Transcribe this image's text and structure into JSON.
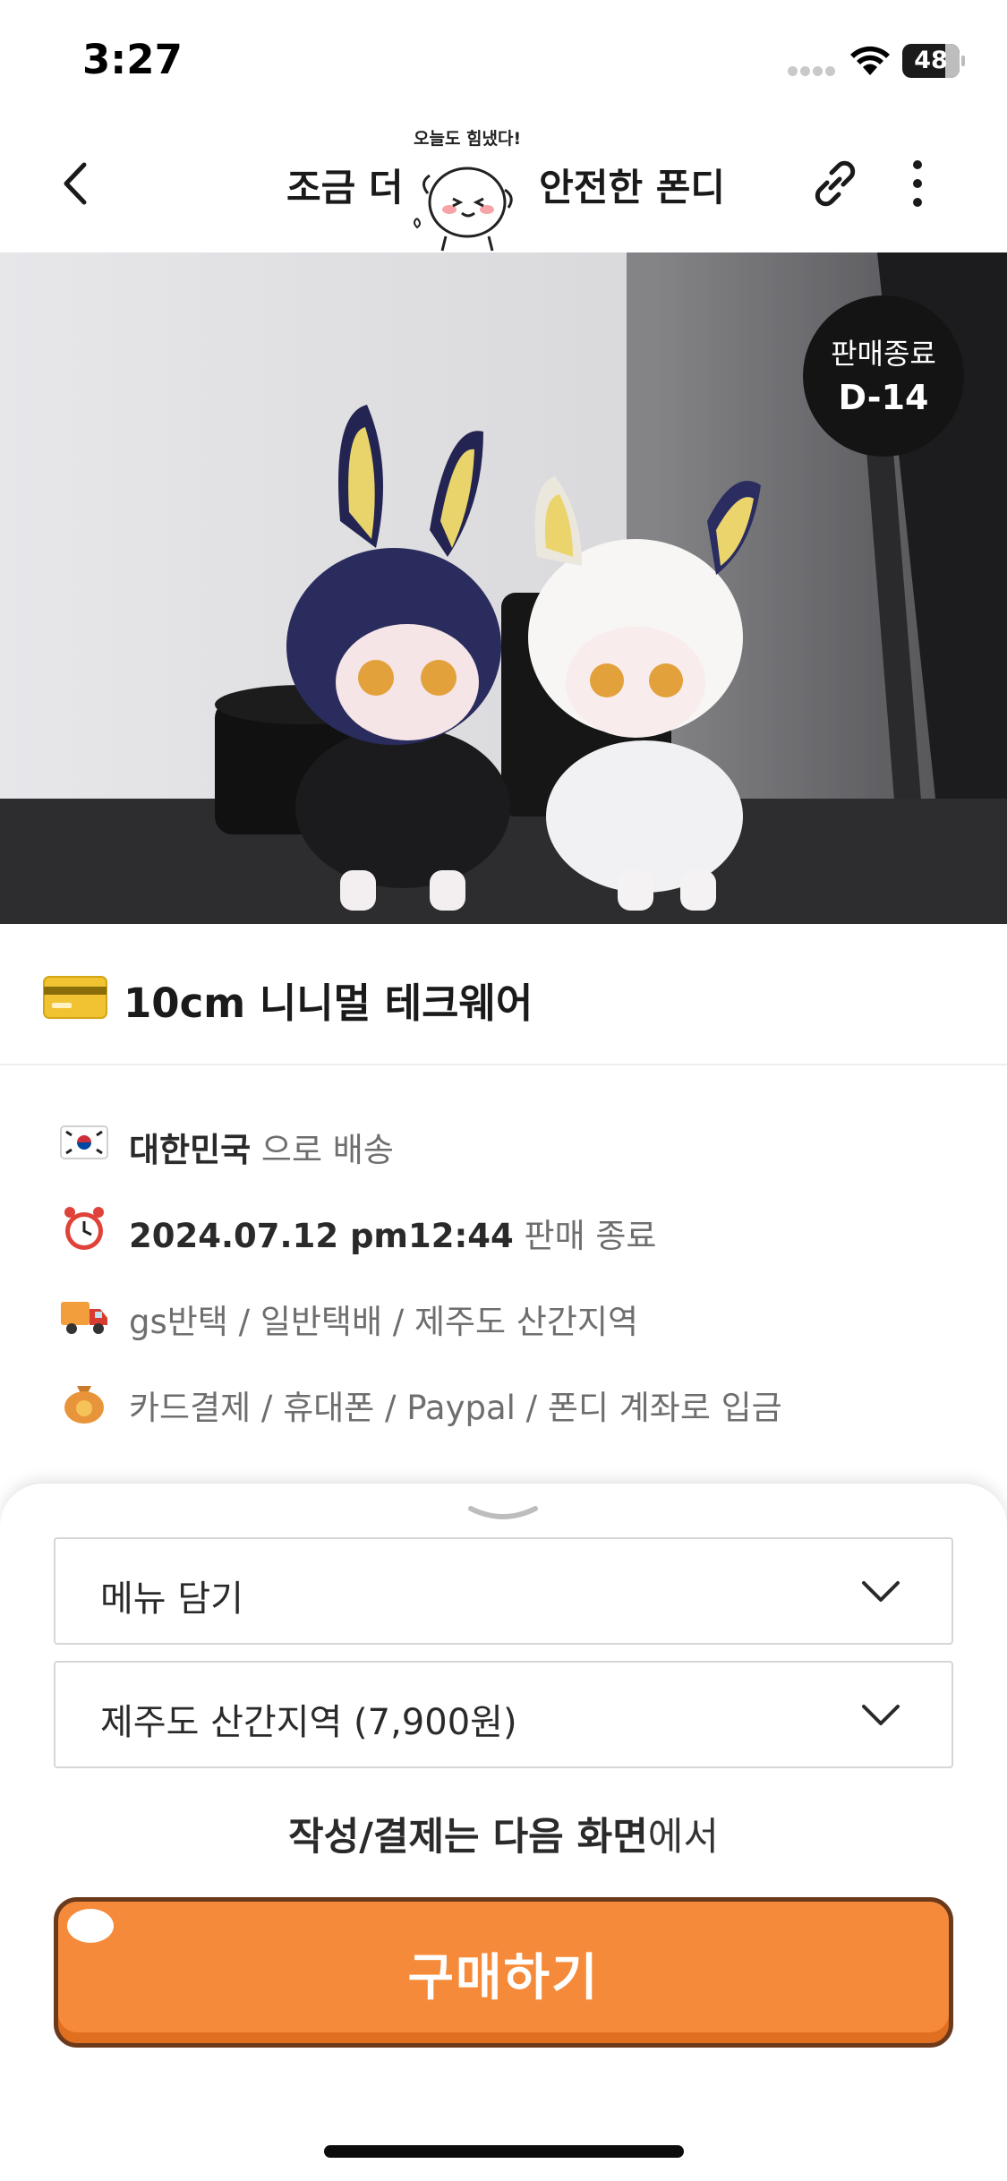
{
  "status_bar": {
    "time": "3:27",
    "battery_level": "48"
  },
  "header": {
    "brand_left": "조금 더",
    "brand_right": "안전한 폰디",
    "brand_bubble": "오늘도 힘냈다!",
    "icons": {
      "back": "chevron-left-icon",
      "link": "link-icon",
      "more": "more-vertical-icon"
    }
  },
  "hero": {
    "deadline_label": "판매종료",
    "deadline_value": "D-14"
  },
  "product": {
    "title_icon": "credit-card-icon",
    "title": "10cm 니니멀 테크웨어"
  },
  "info": {
    "shipping": {
      "icon": "korea-flag-icon",
      "bold": "대한민국",
      "rest": " 으로 배송"
    },
    "deadline": {
      "icon": "alarm-clock-icon",
      "bold": "2024.07.12 pm12:44",
      "rest": " 판매 종료"
    },
    "delivery": {
      "icon": "delivery-truck-icon",
      "text": "gs반택 / 일반택배 / 제주도 산간지역"
    },
    "payment": {
      "icon": "money-bag-icon",
      "text": "카드결제 / 휴대폰 / Paypal / 폰디 계좌로 입금"
    }
  },
  "sheet": {
    "menu_select": "메뉴 담기",
    "shipping_select": "제주도 산간지역 (7,900원)",
    "note_bold": "작성/결제는 다음 화면",
    "note_rest": "에서",
    "buy_label": "구매하기"
  },
  "colors": {
    "accent": "#f58b3a",
    "accent_border": "#6b3a1a",
    "badge_bg": "#141414"
  }
}
